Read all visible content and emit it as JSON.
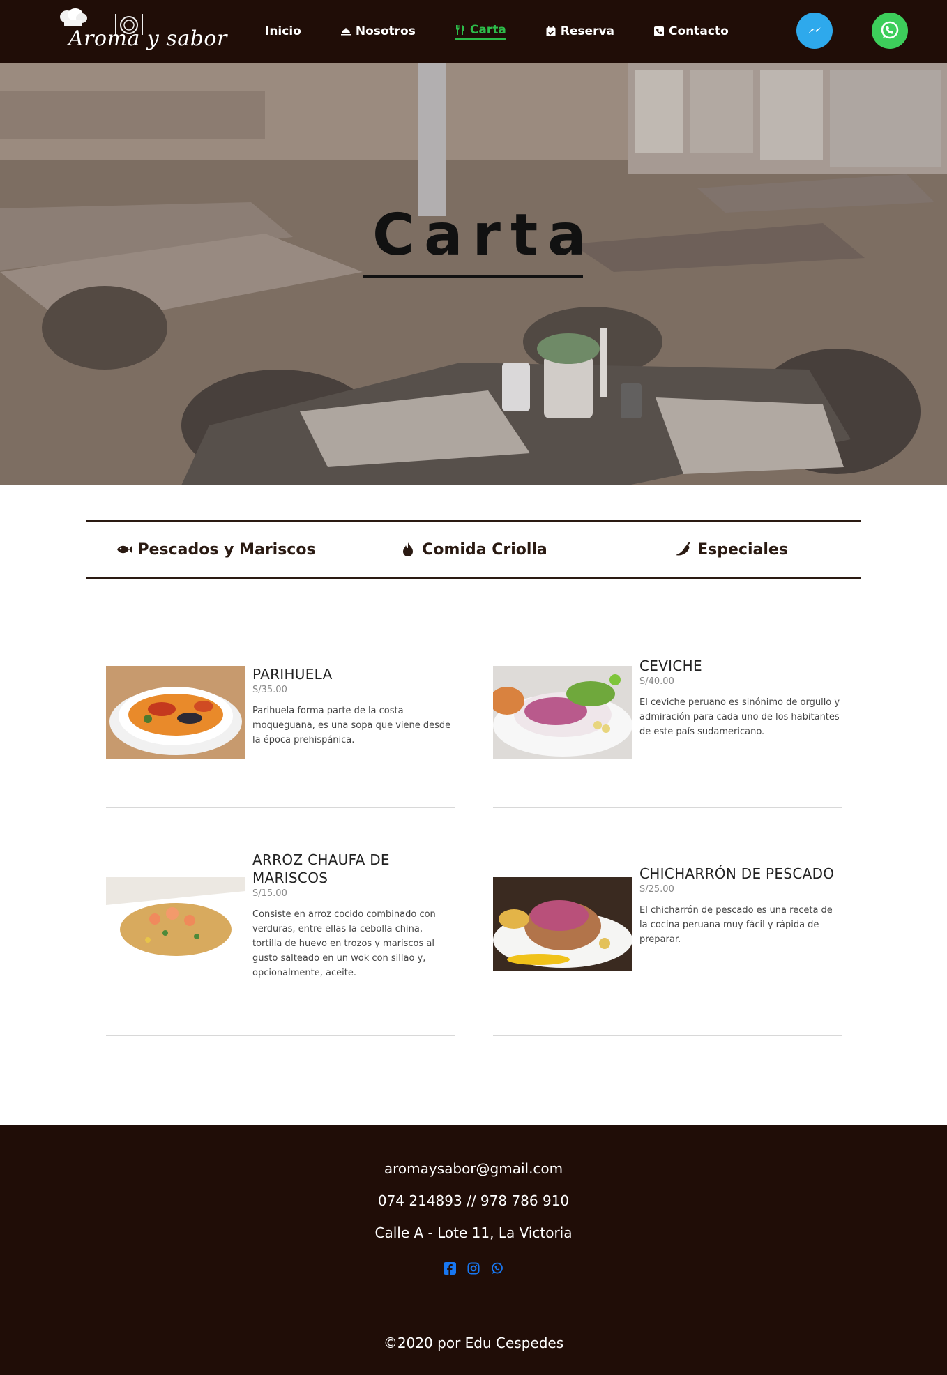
{
  "brand": {
    "logo_text": "Aroma y sabor"
  },
  "nav": {
    "items": [
      {
        "label": "Inicio",
        "icon": ""
      },
      {
        "label": "Nosotros",
        "icon": "cloche-icon"
      },
      {
        "label": "Carta",
        "icon": "utensils-icon",
        "active": true
      },
      {
        "label": "Reserva",
        "icon": "calendar-check-icon"
      },
      {
        "label": "Contacto",
        "icon": "phone-square-icon"
      }
    ],
    "messenger_icon": "messenger-icon",
    "whatsapp_icon": "whatsapp-icon"
  },
  "hero": {
    "title": "Carta"
  },
  "tabs": [
    {
      "label": "Pescados y Mariscos",
      "icon": "fish-icon"
    },
    {
      "label": "Comida Criolla",
      "icon": "fire-icon"
    },
    {
      "label": "Especiales",
      "icon": "pepper-icon"
    }
  ],
  "menu": [
    {
      "name": "PARIHUELA",
      "price": "S/35.00",
      "description": "Parihuela forma parte de la costa moqueguana, es una sopa que viene desde la época prehispánica."
    },
    {
      "name": "CEVICHE",
      "price": "S/40.00",
      "description": "El ceviche peruano es sinónimo de orgullo y admiración para cada uno de los habitantes de este país sudamericano."
    },
    {
      "name": "ARROZ CHAUFA DE MARISCOS",
      "price": "S/15.00",
      "description": "Consiste en arroz cocido combinado con verduras, entre ellas la cebolla china, tortilla de huevo en trozos y mariscos al gusto salteado en un wok con sillao y, opcionalmente, aceite."
    },
    {
      "name": "CHICHARRÓN DE PESCADO",
      "price": "S/25.00",
      "description": "El chicharrón de pescado es una receta de la cocina peruana muy fácil y rápida de preparar."
    }
  ],
  "footer": {
    "email": "aromaysabor@gmail.com",
    "phones": "074 214893 // 978 786 910",
    "address": "Calle A - Lote 11, La Victoria",
    "social_icons": [
      "facebook-icon",
      "instagram-icon",
      "whatsapp-icon"
    ],
    "copyright": "©2020 por Edu Cespedes"
  },
  "colors": {
    "nav_bg": "#200d07",
    "active": "#2dbc4a",
    "social_blue": "#1877f2"
  }
}
